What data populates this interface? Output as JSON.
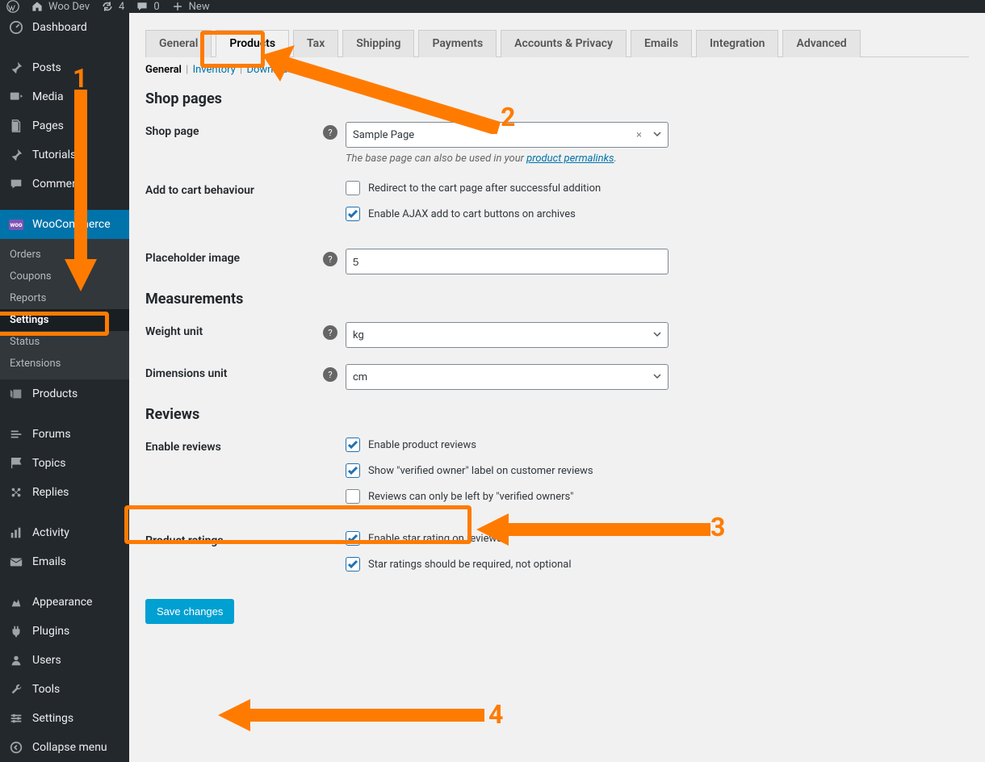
{
  "admin_bar": {
    "site_name": "Woo Dev",
    "updates_count": "4",
    "comments_count": "0",
    "new_label": "New"
  },
  "sidebar": {
    "items": [
      {
        "label": "Dashboard"
      },
      {
        "label": "Posts"
      },
      {
        "label": "Media"
      },
      {
        "label": "Pages"
      },
      {
        "label": "Tutorials"
      },
      {
        "label": "Comments"
      },
      {
        "label": "WooCommerce"
      },
      {
        "label": "Products"
      },
      {
        "label": "Forums"
      },
      {
        "label": "Topics"
      },
      {
        "label": "Replies"
      },
      {
        "label": "Activity"
      },
      {
        "label": "Emails"
      },
      {
        "label": "Appearance"
      },
      {
        "label": "Plugins"
      },
      {
        "label": "Users"
      },
      {
        "label": "Tools"
      },
      {
        "label": "Settings"
      },
      {
        "label": "Collapse menu"
      }
    ],
    "submenu": [
      {
        "label": "Orders"
      },
      {
        "label": "Coupons"
      },
      {
        "label": "Reports"
      },
      {
        "label": "Settings"
      },
      {
        "label": "Status"
      },
      {
        "label": "Extensions"
      }
    ]
  },
  "tabs": [
    {
      "label": "General"
    },
    {
      "label": "Products"
    },
    {
      "label": "Tax"
    },
    {
      "label": "Shipping"
    },
    {
      "label": "Payments"
    },
    {
      "label": "Accounts & Privacy"
    },
    {
      "label": "Emails"
    },
    {
      "label": "Integration"
    },
    {
      "label": "Advanced"
    }
  ],
  "subtabs": {
    "general": "General",
    "inventory": "Inventory",
    "downloadable": "Downloadable"
  },
  "sections": {
    "shop_pages": "Shop pages",
    "measurements": "Measurements",
    "reviews": "Reviews"
  },
  "fields": {
    "shop_page": {
      "label": "Shop page",
      "value": "Sample Page",
      "desc_prefix": "The base page can also be used in your ",
      "desc_link": "product permalinks",
      "desc_suffix": "."
    },
    "add_to_cart": {
      "label": "Add to cart behaviour",
      "opt_redirect": "Redirect to the cart page after successful addition",
      "opt_ajax": "Enable AJAX add to cart buttons on archives"
    },
    "placeholder_image": {
      "label": "Placeholder image",
      "value": "5"
    },
    "weight_unit": {
      "label": "Weight unit",
      "value": "kg"
    },
    "dimensions_unit": {
      "label": "Dimensions unit",
      "value": "cm"
    },
    "enable_reviews": {
      "label": "Enable reviews",
      "opt_enable": "Enable product reviews",
      "opt_verified": "Show \"verified owner\" label on customer reviews",
      "opt_only_verified": "Reviews can only be left by \"verified owners\""
    },
    "product_ratings": {
      "label": "Product ratings",
      "opt_star": "Enable star rating on reviews",
      "opt_required": "Star ratings should be required, not optional"
    }
  },
  "save_button": "Save changes",
  "annotations": {
    "n1": "1",
    "n2": "2",
    "n3": "3",
    "n4": "4"
  }
}
